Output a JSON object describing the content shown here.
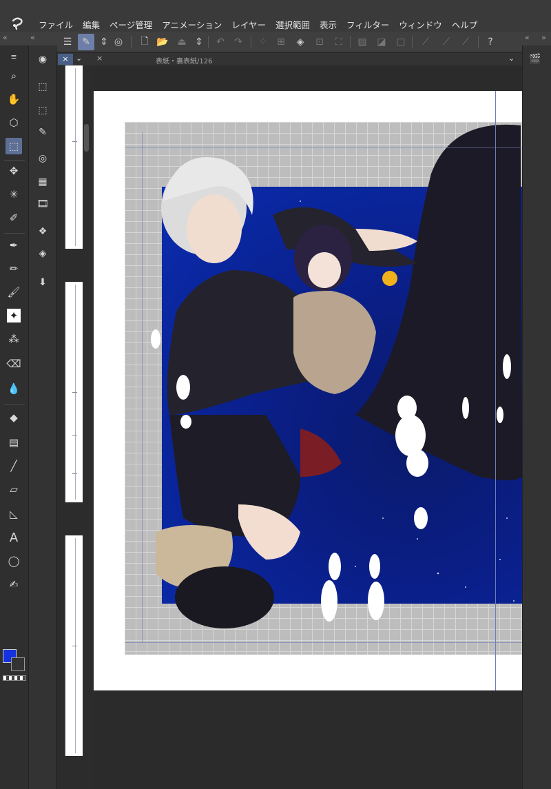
{
  "menu": {
    "items": [
      "ファイル",
      "編集",
      "ページ管理",
      "アニメーション",
      "レイヤー",
      "選択範囲",
      "表示",
      "フィルター",
      "ウィンドウ",
      "ヘルプ"
    ]
  },
  "document": {
    "tab_title": "表紙・裏表紙/126"
  },
  "colors": {
    "foreground": "#1432e0",
    "background": "#333333",
    "accent": "#5e6f96"
  },
  "tools": {
    "left": [
      "zoom-icon",
      "hand-icon",
      "object-icon",
      "selection-icon",
      "move-icon",
      "auto-select-icon",
      "eyedropper-icon",
      "pen-icon",
      "pencil-icon",
      "brush-icon",
      "decoration-icon",
      "airbrush-icon",
      "eraser-icon",
      "blend-icon",
      "fill-icon",
      "gradient-icon",
      "line-icon",
      "frame-icon",
      "ruler-icon",
      "text-icon",
      "balloon-icon",
      "correct-line-icon"
    ],
    "sub": [
      "navigator-icon",
      "layer-property-icon",
      "layer-search-icon",
      "brush-size-icon",
      "color-circle-icon",
      "color-set-icon",
      "animation-icon",
      "material-icon",
      "layers-icon",
      "import-icon"
    ]
  },
  "artwork": {
    "caption": ""
  }
}
